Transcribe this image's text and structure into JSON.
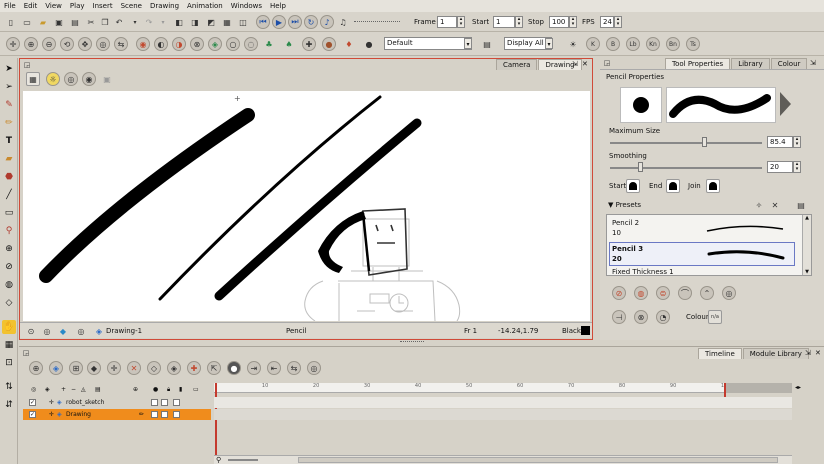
{
  "menubar": [
    "File",
    "Edit",
    "View",
    "Play",
    "Insert",
    "Scene",
    "Drawing",
    "Animation",
    "Windows",
    "Help"
  ],
  "playback": {
    "frame_label": "Frame",
    "frame_value": "1",
    "start_label": "Start",
    "start_value": "1",
    "stop_label": "Stop",
    "stop_value": "100",
    "fps_label": "FPS",
    "fps_value": "24"
  },
  "toolbar2": {
    "palette_select": "Default",
    "display_select": "Display All",
    "shortcut_keys": [
      "K",
      "B",
      "Lb",
      "Kn",
      "Bn",
      "Ts"
    ]
  },
  "view": {
    "tabs": [
      "Camera",
      "Drawing"
    ],
    "active_tab": "Drawing",
    "status": {
      "drawing_name": "Drawing-1",
      "tool": "Pencil",
      "frame": "Fr 1",
      "coords": "-14.24,1.79",
      "colour": "Black"
    }
  },
  "right_panel": {
    "tabs": [
      "Tool Properties",
      "Library",
      "Colour"
    ],
    "active_tab": "Tool Properties",
    "section_title": "Pencil Properties",
    "max_size_label": "Maximum Size",
    "max_size_value": "85.4",
    "max_size_level": 0.62,
    "smoothing_label": "Smoothing",
    "smoothing_value": "20",
    "smoothing_level": 0.2,
    "start_label": "Start",
    "end_label": "End",
    "join_label": "Join",
    "presets_label": "Presets",
    "presets": [
      {
        "name": "Pencil 2",
        "size": "10",
        "selected": false
      },
      {
        "name": "Pencil 3",
        "size": "20",
        "selected": true
      },
      {
        "name": "Fixed Thickness 1",
        "size": "",
        "selected": false
      }
    ],
    "colour_label": "Colour"
  },
  "timeline": {
    "tabs": [
      "Timeline",
      "Module Library"
    ],
    "active_tab": "Timeline",
    "ruler_ticks": [
      "10",
      "20",
      "30",
      "40",
      "50",
      "60",
      "70",
      "80",
      "90",
      "100"
    ],
    "layers": [
      {
        "name": "robot_sketch",
        "selected": false
      },
      {
        "name": "Drawing",
        "selected": true
      }
    ]
  }
}
